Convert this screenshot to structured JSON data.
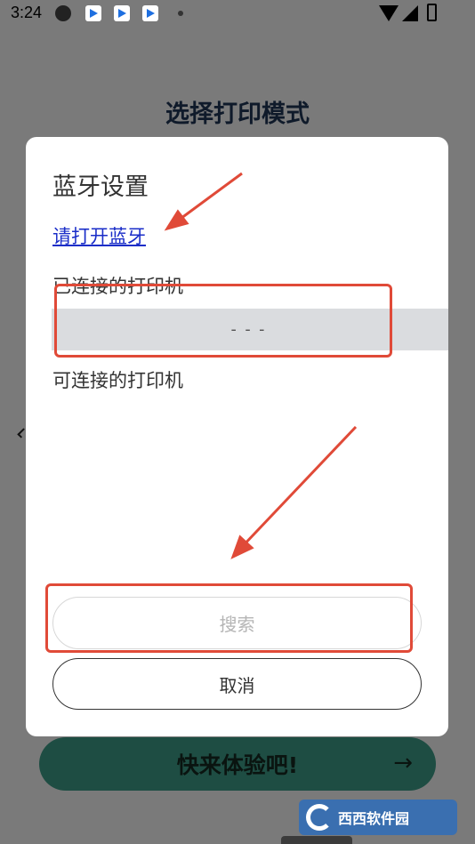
{
  "status_bar": {
    "time": "3:24",
    "icons": [
      "telegram-icon",
      "app-icon",
      "app-icon",
      "app-icon",
      "dot-icon",
      "wifi-icon",
      "signal-icon",
      "battery-icon"
    ]
  },
  "background_page": {
    "title": "选择打印模式",
    "cta_label": "快来体验吧!",
    "cta_arrow": "→",
    "cta_color": "#1e4d43"
  },
  "dialog": {
    "title": "蓝牙设置",
    "bluetooth_link": "请打开蓝牙",
    "connected_label": "已连接的打印机",
    "connected_printer": "---",
    "available_label": "可连接的打印机",
    "search_label": "搜索",
    "cancel_label": "取消"
  },
  "annotation_color": "#e04a38",
  "watermark": {
    "text": "西西软件园"
  }
}
